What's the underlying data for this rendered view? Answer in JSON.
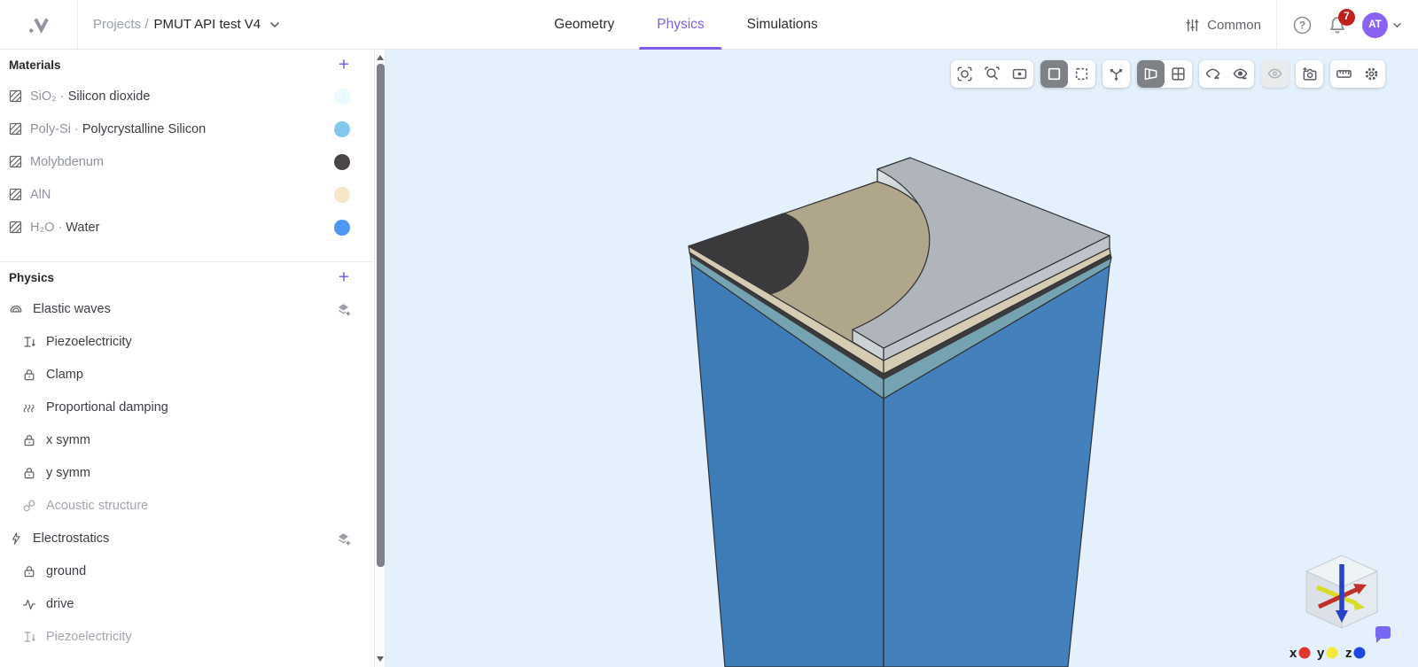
{
  "header": {
    "breadcrumb": {
      "section": "Projects /",
      "project": "PMUT API test V4"
    },
    "tabs": [
      {
        "label": "Geometry"
      },
      {
        "label": "Physics"
      },
      {
        "label": "Simulations"
      }
    ],
    "right": {
      "common_label": "Common",
      "notification_count": "7",
      "avatar_initials": "AT"
    }
  },
  "sidebar": {
    "materials": {
      "title": "Materials",
      "add_label": "+",
      "items": [
        {
          "prefix": "SiO₂ · ",
          "name": "Silicon dioxide",
          "swatch": "#EAFAFE"
        },
        {
          "prefix": "Poly-Si · ",
          "name": "Polycrystalline Silicon",
          "swatch": "#82C9EC"
        },
        {
          "prefix": "Molybdenum",
          "name": "",
          "swatch": "#4A4648"
        },
        {
          "prefix": "AlN",
          "name": "",
          "swatch": "#F5E7C8"
        },
        {
          "prefix": "H₂O · ",
          "name": "Water",
          "swatch": "#4F96F0"
        }
      ]
    },
    "physics": {
      "title": "Physics",
      "add_label": "+",
      "groups": [
        {
          "label": "Elastic waves",
          "icon": "elastic-waves-icon",
          "children": [
            {
              "label": "Piezoelectricity",
              "icon": "piezo-icon",
              "muted": false
            },
            {
              "label": "Clamp",
              "icon": "lock-icon",
              "muted": false
            },
            {
              "label": "Proportional damping",
              "icon": "damping-icon",
              "muted": false
            },
            {
              "label": "x symm",
              "icon": "lock-icon",
              "muted": false
            },
            {
              "label": "y symm",
              "icon": "lock-icon",
              "muted": false
            },
            {
              "label": "Acoustic structure",
              "icon": "link-icon",
              "muted": true
            }
          ]
        },
        {
          "label": "Electrostatics",
          "icon": "bolt-icon",
          "children": [
            {
              "label": "ground",
              "icon": "lock-icon",
              "muted": false
            },
            {
              "label": "drive",
              "icon": "pulse-icon",
              "muted": false
            },
            {
              "label": "Piezoelectricity",
              "icon": "piezo-icon",
              "muted": true
            }
          ]
        }
      ]
    }
  },
  "viewport": {
    "toolbar_icons": [
      "focus-selection-icon",
      "zoom-region-icon",
      "fit-view-icon",
      "box-select-solid-icon",
      "box-select-dashed-icon",
      "axes-icon",
      "perspective-view-icon",
      "quad-view-icon",
      "hide-faces-eye-icon",
      "hide-edges-eye-icon",
      "hidden-eye-disabled-icon",
      "screenshot-camera-icon",
      "ruler-icon",
      "settings-gear-icon"
    ],
    "gizmo": {
      "x_label": "x",
      "y_label": "y",
      "z_label": "z",
      "x_color": "#E03630",
      "y_color": "#F2E93B",
      "z_color": "#1F48E0"
    }
  },
  "colors": {
    "accent": "#7C5CEA",
    "avatar_bg": "#8A63F2",
    "badge_bg": "#C0201E",
    "viewport_bg": "#E4F1FC",
    "model": {
      "substrate_left": "#3E7CB8",
      "substrate_right": "#4380BC",
      "teal_layer": "#76A3B2",
      "dark_layer": "#3B3B3D",
      "cream_side": "#D6CCB4",
      "tan_top": "#B0A68C",
      "dark_disc": "#3A3A3C",
      "slab_top": "#AFB5BB",
      "slab_light": "#CDD2D7",
      "slab_right": "#BEC4CA",
      "outline": "#2F3033"
    }
  }
}
